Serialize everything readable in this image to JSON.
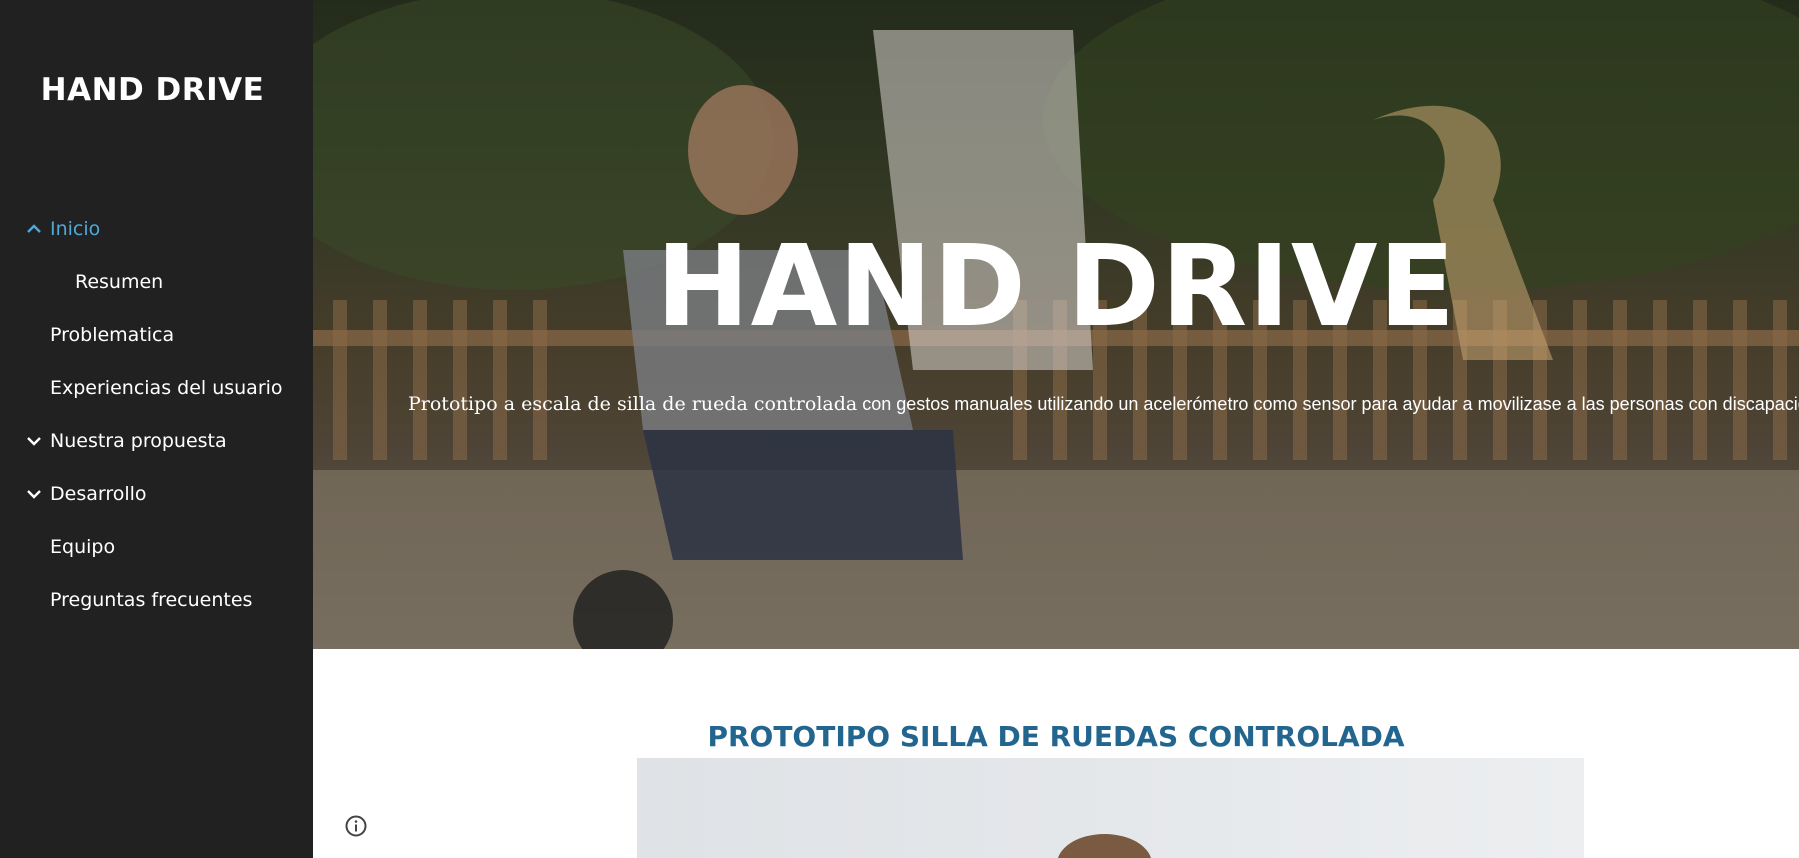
{
  "sidebar": {
    "site_title": "HAND DRIVE",
    "items": [
      {
        "label": "Inicio",
        "icon": "chevron-up-icon",
        "active": true
      },
      {
        "label": "Resumen",
        "sub": true
      },
      {
        "label": "Problematica"
      },
      {
        "label": "Experiencias del usuario"
      },
      {
        "label": "Nuestra propuesta",
        "icon": "chevron-down-icon"
      },
      {
        "label": "Desarrollo",
        "icon": "chevron-down-icon"
      },
      {
        "label": "Equipo"
      },
      {
        "label": "Preguntas frecuentes"
      }
    ]
  },
  "hero": {
    "title": "HAND DRIVE",
    "subtitle_part1": "Prototipo a escala de silla de rueda controlada",
    "subtitle_part2": " con gestos manuales utilizando un acelerómetro como sensor para ayudar a movilizase a las personas con discapacidad"
  },
  "main": {
    "section_title": "PROTOTIPO SILLA DE RUEDAS CONTROLADA"
  },
  "colors": {
    "sidebar_bg": "#212121",
    "active_link": "#4fa8d8",
    "section_title": "#22668f"
  }
}
